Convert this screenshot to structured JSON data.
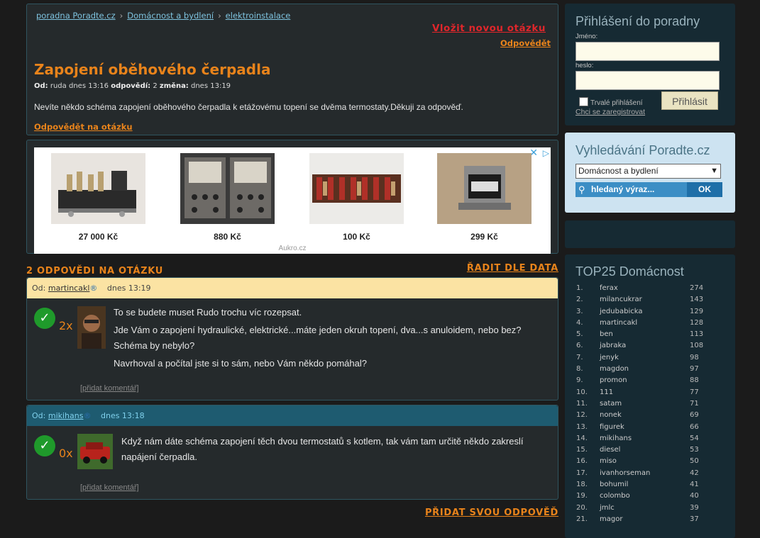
{
  "breadcrumb": [
    "poradna Poradte.cz",
    "Domácnost a bydlení",
    "elektroinstalace"
  ],
  "new_question": "Vložit novou otázku",
  "reply_top": "Odpovědět",
  "question": {
    "title": "Zapojení oběhového čerpadla",
    "from_label": "Od:",
    "author": "ruda",
    "date": "dnes 13:16",
    "answers_label": "odpovědí:",
    "answers_count": "2",
    "changed_label": "změna:",
    "changed": "dnes 13:19",
    "text": "Nevíte někdo schéma zapojení oběhového čerpadla k etážovému topení se dvěma termostaty.Děkuji za odpověď.",
    "reply_link": "Odpovědět na otázku"
  },
  "ads": {
    "items": [
      {
        "price": "27 000 Kč",
        "icon": "amplifier-image"
      },
      {
        "price": "880 Kč",
        "icon": "meter-panel-image"
      },
      {
        "price": "100 Kč",
        "icon": "resistors-image"
      },
      {
        "price": "299 Kč",
        "icon": "transformer-image"
      }
    ],
    "source": "Aukro.cz"
  },
  "answers_header": {
    "count": "2 ODPOVĚDI NA OTÁZKU",
    "sort": "ŘADIT DLE DATA"
  },
  "answers": [
    {
      "from_label": "Od:",
      "author": "martincakl",
      "badge": "®",
      "time": "dnes 13:19",
      "votes": "2x",
      "paragraphs": [
        "To se budete muset Rudo trochu víc rozepsat.",
        "Jde Vám o zapojení hydraulické, elektrické...máte jeden okruh topení, dva...s anuloidem, nebo bez? Schéma by nebylo?",
        "Navrhoval a počítal jste si to sám, nebo Vám někdo pomáhal?"
      ],
      "comment": "[přidat komentář]"
    },
    {
      "from_label": "Od:",
      "author": "mikihans",
      "badge": "®",
      "time": "dnes 13:18",
      "votes": "0x",
      "paragraphs": [
        "Když nám dáte schéma zapojení těch dvou termostatů s kotlem, tak vám tam určitě někdo zakreslí napájení čerpadla."
      ],
      "comment": "[přidat komentář]"
    }
  ],
  "add_answer": "PŘIDAT SVOU ODPOVĚĎ",
  "login": {
    "title": "Přihlášení do poradny",
    "name_label": "Jméno:",
    "password_label": "heslo:",
    "remember": "Trvalé přihlášení",
    "register": "Chci se zaregistrovat",
    "button": "Přihlásit"
  },
  "search": {
    "title": "Vyhledávání Poradte.cz",
    "category": "Domácnost a bydlení",
    "placeholder": "hledaný výraz...",
    "button": "OK"
  },
  "top": {
    "title": "TOP25 Domácnost",
    "rows": [
      {
        "rank": "1.",
        "name": "ferax",
        "score": "274"
      },
      {
        "rank": "2.",
        "name": "milancukrar",
        "score": "143"
      },
      {
        "rank": "3.",
        "name": "jedubabicka",
        "score": "129"
      },
      {
        "rank": "4.",
        "name": "martincakl",
        "score": "128"
      },
      {
        "rank": "5.",
        "name": "ben",
        "score": "113"
      },
      {
        "rank": "6.",
        "name": "jabraka",
        "score": "108"
      },
      {
        "rank": "7.",
        "name": "jenyk",
        "score": "98"
      },
      {
        "rank": "8.",
        "name": "magdon",
        "score": "97"
      },
      {
        "rank": "9.",
        "name": "promon",
        "score": "88"
      },
      {
        "rank": "10.",
        "name": "111",
        "score": "77"
      },
      {
        "rank": "11.",
        "name": "satam",
        "score": "71"
      },
      {
        "rank": "12.",
        "name": "nonek",
        "score": "69"
      },
      {
        "rank": "13.",
        "name": "figurek",
        "score": "66"
      },
      {
        "rank": "14.",
        "name": "mikihans",
        "score": "54"
      },
      {
        "rank": "15.",
        "name": "diesel",
        "score": "53"
      },
      {
        "rank": "16.",
        "name": "miso",
        "score": "50"
      },
      {
        "rank": "17.",
        "name": "ivanhorseman",
        "score": "42"
      },
      {
        "rank": "18.",
        "name": "bohumil",
        "score": "41"
      },
      {
        "rank": "19.",
        "name": "colombo",
        "score": "40"
      },
      {
        "rank": "20.",
        "name": "jmlc",
        "score": "39"
      },
      {
        "rank": "21.",
        "name": "magor",
        "score": "37"
      }
    ]
  }
}
